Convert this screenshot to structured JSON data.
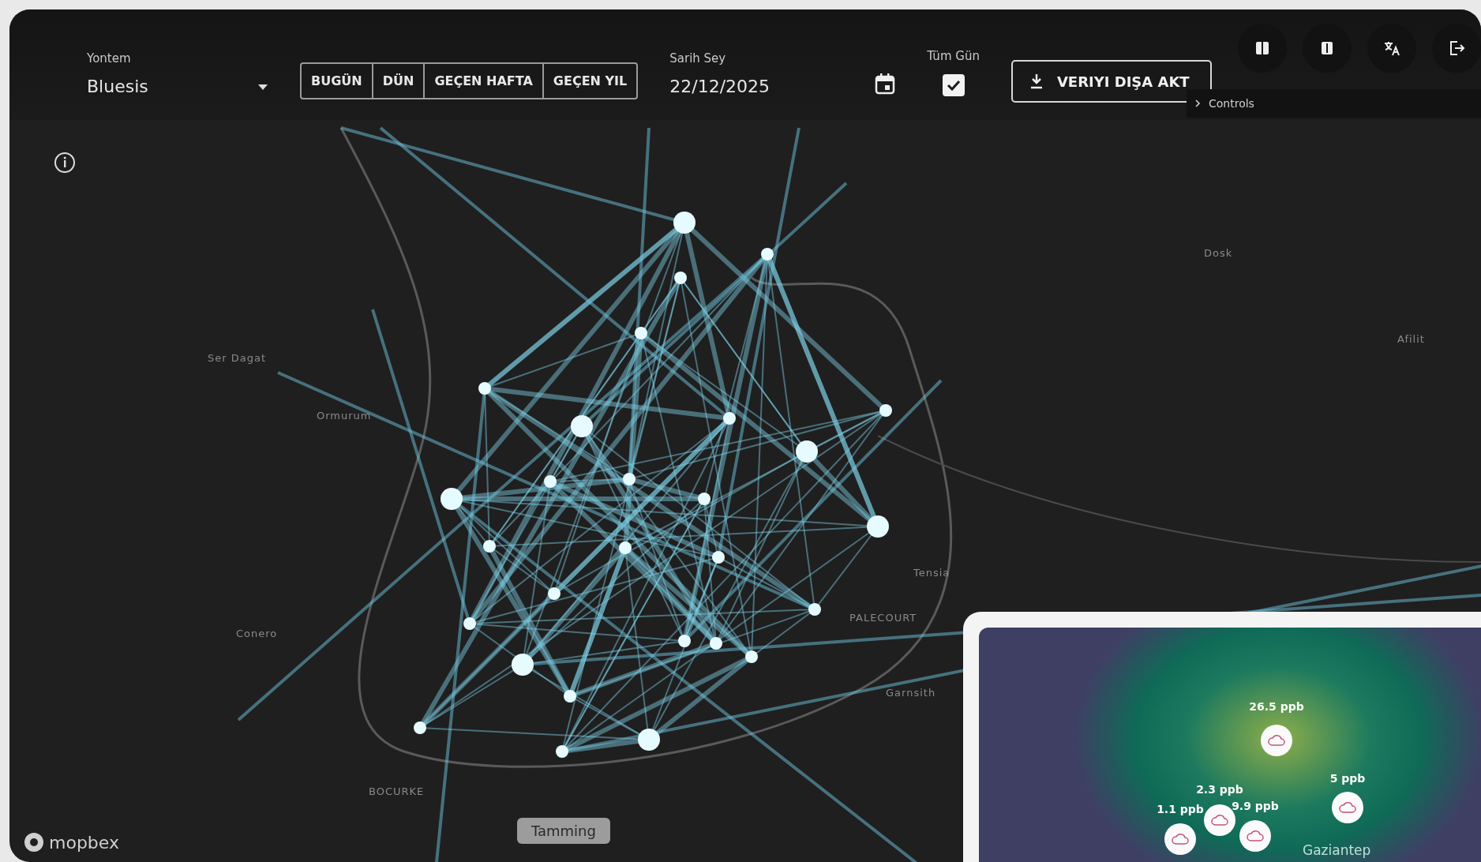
{
  "toolbar": {
    "method": {
      "label": "Yontem",
      "value": "Bluesis"
    },
    "ranges": [
      {
        "label": "BUGÜN",
        "selected": false
      },
      {
        "label": "DÜN",
        "selected": false
      },
      {
        "label": "GEÇEN HAFTA",
        "selected": false
      },
      {
        "label": "GEÇEN YIL",
        "selected": false
      }
    ],
    "date": {
      "label": "Sarih Sey",
      "value": "22/12/2025"
    },
    "all_day": {
      "label": "Tüm Gün",
      "checked": true
    },
    "export_button": "VERIYI DIŞA AKT"
  },
  "controls_panel": {
    "label": "Controls",
    "expanded": false
  },
  "map": {
    "labels": [
      {
        "text": "Ser Dagat"
      },
      {
        "text": "Ormurum"
      },
      {
        "text": "Conero"
      },
      {
        "text": "Dosk"
      },
      {
        "text": "Afilit"
      },
      {
        "text": "Tensia"
      },
      {
        "text": "PALECOURT"
      },
      {
        "text": "BOCURKE"
      },
      {
        "text": "Garnsith"
      }
    ],
    "tooltip": "Tamming",
    "attribution": "mopbex"
  },
  "inset_map": {
    "readings": [
      {
        "value": "26.5 ppb"
      },
      {
        "value": "2.3 ppb"
      },
      {
        "value": "1.1 ppb"
      },
      {
        "value": "9.9 ppb"
      },
      {
        "value": "5 ppb"
      }
    ],
    "place": "Gaziantep"
  }
}
